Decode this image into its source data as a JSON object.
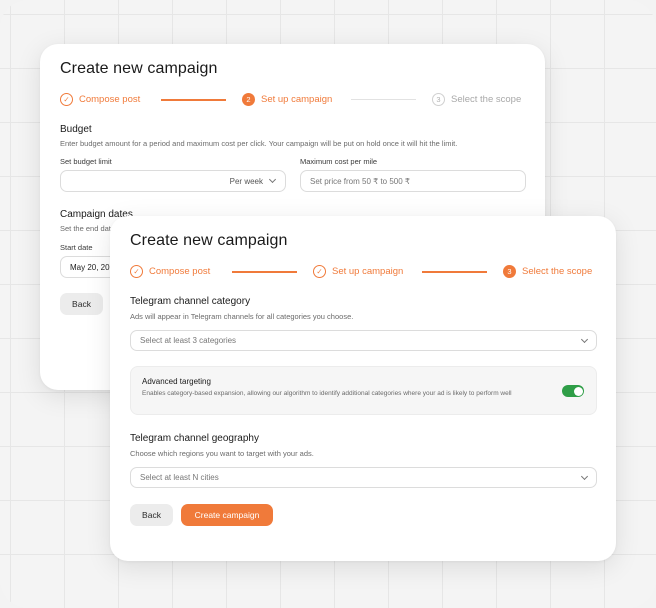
{
  "back_card": {
    "title": "Create new campaign",
    "steps": [
      {
        "number": "1",
        "label": "Compose post",
        "state": "done"
      },
      {
        "number": "2",
        "label": "Set up campaign",
        "state": "active"
      },
      {
        "number": "3",
        "label": "Select the scope",
        "state": "pending"
      }
    ],
    "budget": {
      "title": "Budget",
      "description": "Enter budget amount for a period and maximum cost per click. Your campaign will be put on hold once it will hit the limit.",
      "limit_label": "Set budget limit",
      "period_value": "Per week",
      "max_cost_label": "Maximum cost per mile",
      "max_cost_placeholder": "Set price from 50 ₹ to 500 ₹"
    },
    "dates": {
      "title": "Campaign dates",
      "description": "Set the end date",
      "start_label": "Start date",
      "start_value": "May 20, 20"
    },
    "back_button": "Back"
  },
  "front_card": {
    "title": "Create new campaign",
    "steps": [
      {
        "number": "1",
        "label": "Compose post",
        "state": "done"
      },
      {
        "number": "2",
        "label": "Set up campaign",
        "state": "done"
      },
      {
        "number": "3",
        "label": "Select the scope",
        "state": "active"
      }
    ],
    "category": {
      "title": "Telegram channel category",
      "description": "Ads will appear in Telegram channels for all categories you choose.",
      "placeholder": "Select at least 3 categories"
    },
    "advanced": {
      "title": "Advanced targeting",
      "description": "Enables category-based expansion, allowing our algorithm to identify additional categories where your ad is likely to perform well",
      "enabled": true
    },
    "geography": {
      "title": "Telegram channel geography",
      "description": "Choose which regions you want to target with your ads.",
      "placeholder": "Select at least N cities"
    },
    "back_button": "Back",
    "create_button": "Create campaign"
  },
  "colors": {
    "accent": "#f07a3a",
    "toggle_on": "#2f9e47"
  },
  "icons": {
    "done_step": "check-circle-icon",
    "dropdown": "chevron-down-icon"
  }
}
